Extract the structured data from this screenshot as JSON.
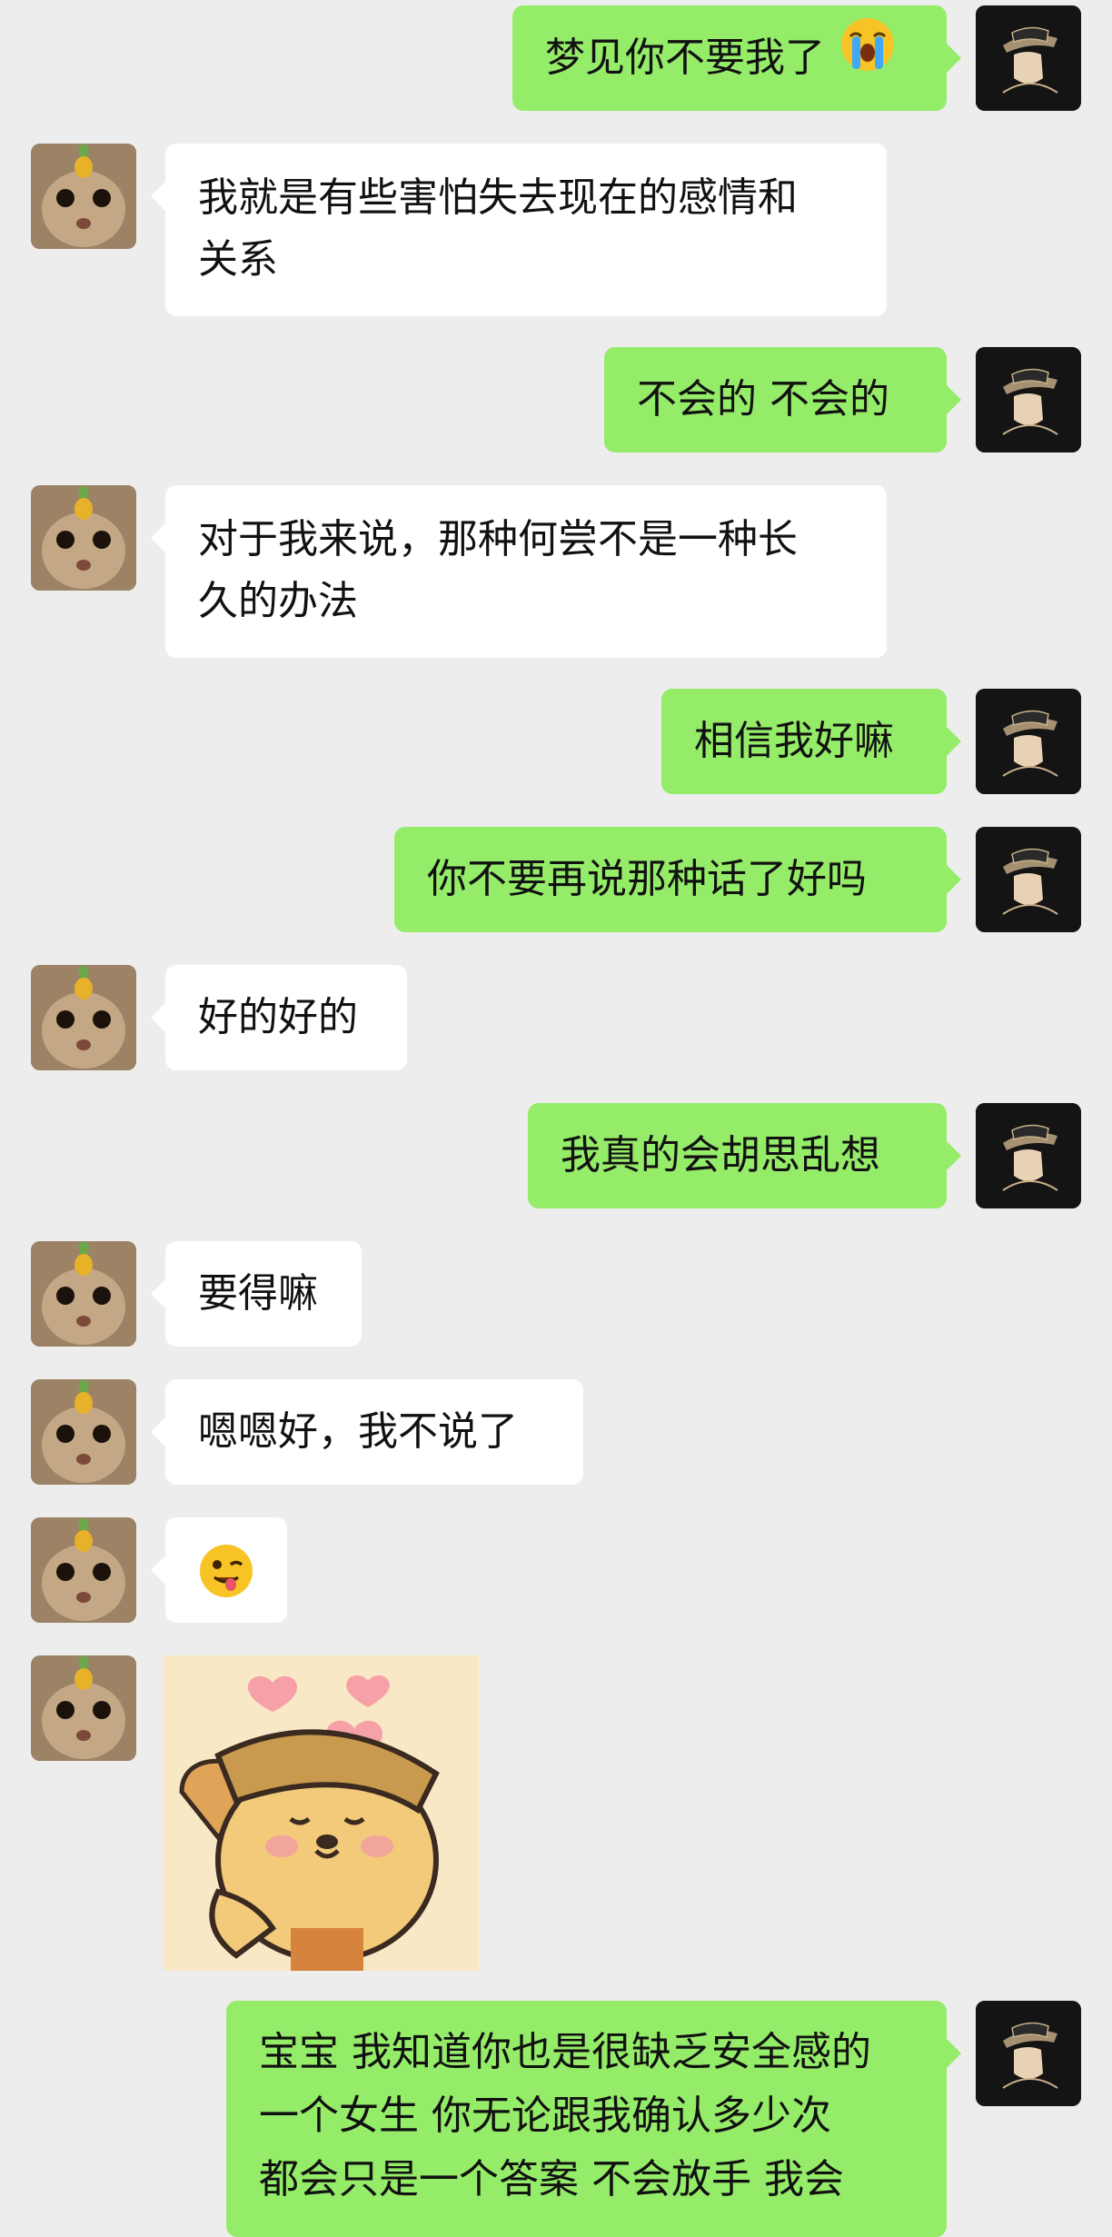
{
  "messages": [
    {
      "side": "me",
      "text": "梦见你不要我了",
      "emoji": "loudly-crying-face"
    },
    {
      "side": "her",
      "lines": [
        "我就是有些害怕失去现在的感情和",
        "关系"
      ]
    },
    {
      "side": "me",
      "text": "不会的 不会的"
    },
    {
      "side": "her",
      "lines": [
        "对于我来说，那种何尝不是一种长",
        "久的办法"
      ]
    },
    {
      "side": "me",
      "text": "相信我好嘛"
    },
    {
      "side": "me",
      "text": "你不要再说那种话了好吗"
    },
    {
      "side": "her",
      "text": "好的好的"
    },
    {
      "side": "me",
      "text": "我真的会胡思乱想"
    },
    {
      "side": "her",
      "text": "要得嘛"
    },
    {
      "side": "her",
      "text": "嗯嗯好，我不说了"
    },
    {
      "side": "her",
      "emoji": "winking-face-with-tongue"
    },
    {
      "side": "her",
      "sticker": "puppy-hugging-hearts-sticker"
    },
    {
      "side": "me",
      "lines": [
        "宝宝 我知道你也是很缺乏安全感的",
        "一个女生 你无论跟我确认多少次",
        "都会只是一个答案 不会放手 我会"
      ]
    }
  ]
}
